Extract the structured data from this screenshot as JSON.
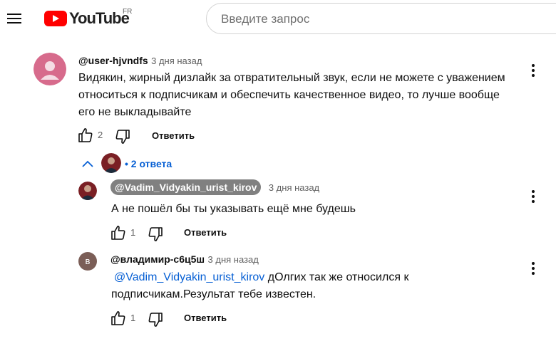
{
  "header": {
    "logo_text": "YouTube",
    "country_code": "FR",
    "search_placeholder": "Введите запрос"
  },
  "comment": {
    "author": "@user-hjvndfs",
    "time": "3 дня назад",
    "text": "Видякин, жирный дизлайк за отвратительный звук, если не можете с уважением относиться к подписчикам и обеспечить качественное видео, то лучше вообще его не выкладывайте",
    "likes": "2",
    "reply_label": "Ответить",
    "avatar_color": "#d76b8c"
  },
  "replies_toggle": {
    "bullet": "•",
    "label": "2 ответа"
  },
  "replies": [
    {
      "author": "@Vadim_Vidyakin_urist_kirov",
      "time": "3 дня назад",
      "text": "А не пошёл бы ты указывать ещё мне будешь",
      "likes": "1",
      "reply_label": "Ответить"
    },
    {
      "author": "@владимир-с6ц5ш",
      "avatar_letter": "в",
      "avatar_color": "#7b5e57",
      "time": "3 дня назад",
      "mention": "@Vadim_Vidyakin_urist_kirov",
      "text_after_mention": "дОлгих так же относился к подписчикам.Результат тебе известен.",
      "likes": "1",
      "reply_label": "Ответить"
    }
  ]
}
